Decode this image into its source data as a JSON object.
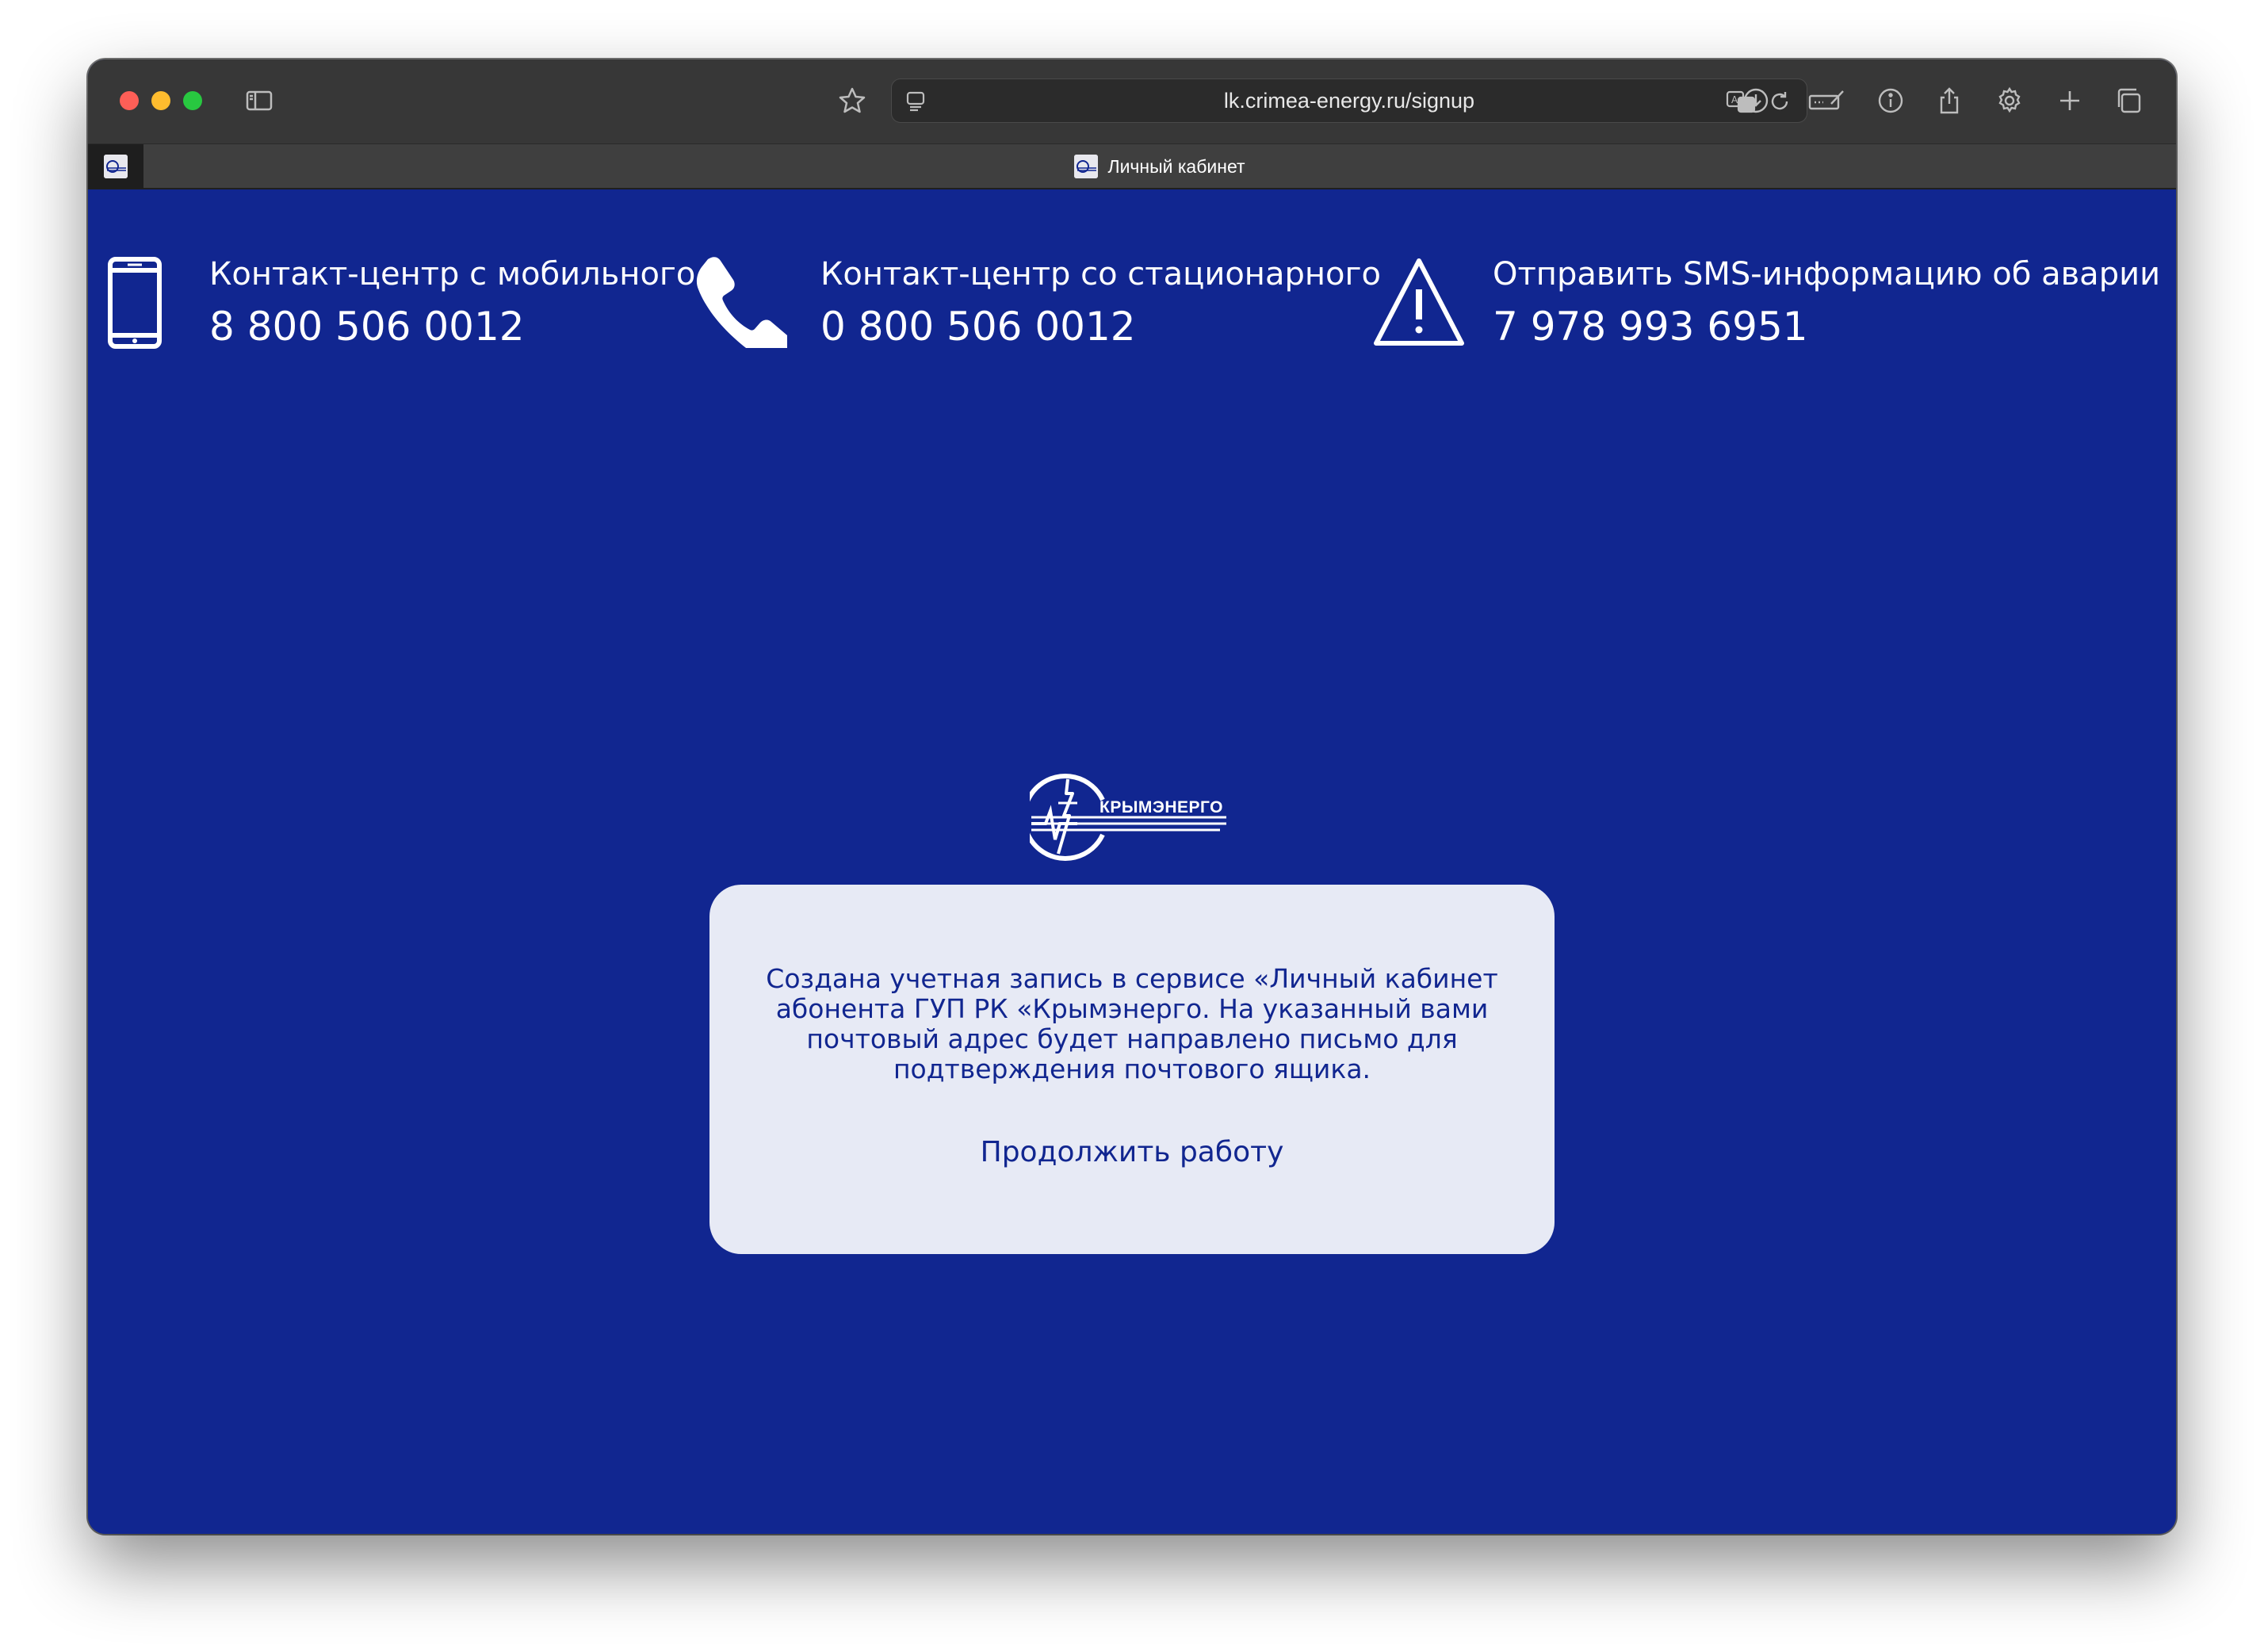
{
  "browser": {
    "url": "lk.crimea-energy.ru/signup",
    "tab_title": "Личный кабинет"
  },
  "contacts": [
    {
      "label": "Контакт-центр с мобильного",
      "number": "8 800 506 0012",
      "icon": "mobile-phone-icon"
    },
    {
      "label": "Контакт-центр со стационарного",
      "number": "0 800 506 0012",
      "icon": "phone-handset-icon"
    },
    {
      "label": "Отправить SMS-информацию об аварии",
      "number": "7 978 993 6951",
      "icon": "warning-icon"
    }
  ],
  "logo": {
    "text": "КРЫМЭНЕРГО"
  },
  "dialog": {
    "message": "Создана учетная запись в сервисе «Личный кабинет абонента ГУП РК «Крымэнерго. На указанный вами почтовый адрес будет направлено письмо для подтверждения почтового ящика.",
    "continue_label": "Продолжить работу"
  },
  "colors": {
    "page_background": "#112690",
    "dialog_background": "#e7eaf5",
    "dialog_text": "#112690",
    "toolbar": "#373737"
  }
}
